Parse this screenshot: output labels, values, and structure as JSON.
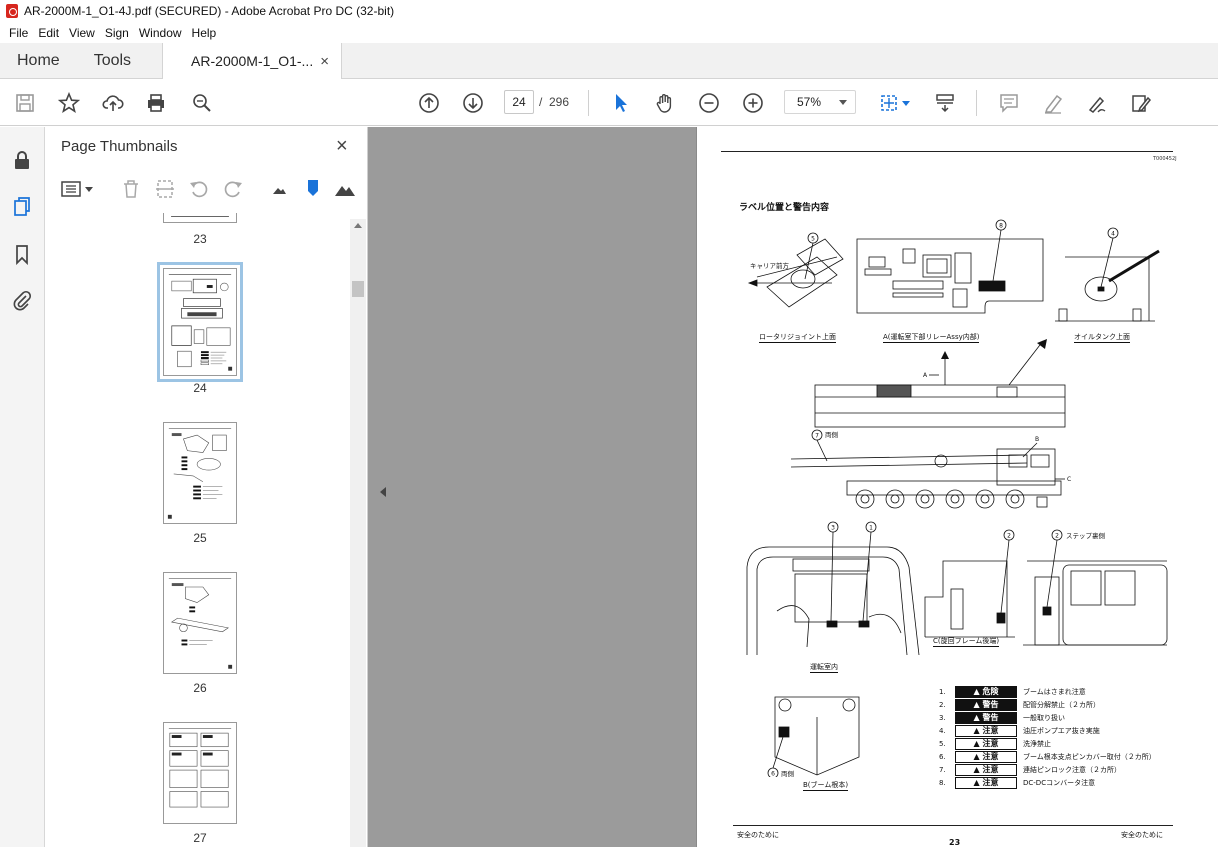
{
  "window": {
    "title": "AR-2000M-1_O1-4J.pdf (SECURED) - Adobe Acrobat Pro DC (32-bit)"
  },
  "menu": {
    "items": [
      "File",
      "Edit",
      "View",
      "Sign",
      "Window",
      "Help"
    ]
  },
  "tabs": {
    "home": "Home",
    "tools": "Tools",
    "document": "AR-2000M-1_O1-...",
    "close": "×"
  },
  "toolbar": {
    "current_page": "24",
    "page_separator": "/",
    "total_pages": "296",
    "zoom": "57%"
  },
  "panel": {
    "title": "Page Thumbnails",
    "close": "×",
    "thumb_labels": [
      "23",
      "24",
      "25",
      "26",
      "27"
    ]
  },
  "page": {
    "code": "T000452J",
    "heading": "ラベル位置と警告内容",
    "captions": {
      "rotary": "ロータリジョイント上面",
      "relay": "A(運転室下部リレーAssy内部)",
      "oil_tank": "オイルタンク上面",
      "cab": "運転室内",
      "frame": "C(旋回フレーム後端)",
      "boom": "B(ブーム根本)"
    },
    "callouts": {
      "carrier_front": "キャリア前方",
      "both_sides_7": "両側",
      "step_back": "ステップ裏側",
      "both_sides_6": "両側",
      "a": "A",
      "b": "B",
      "c": "C",
      "n1": "1",
      "n2": "2",
      "n3": "3",
      "n4": "4",
      "n5": "5",
      "n6": "6",
      "n7": "7",
      "n8": "8"
    },
    "legend": [
      {
        "num": "1.",
        "badge": "危険",
        "style": "dark",
        "text": "ブームはさまれ注意"
      },
      {
        "num": "2.",
        "badge": "警告",
        "style": "dark",
        "text": "配管分解禁止（２カ所）"
      },
      {
        "num": "3.",
        "badge": "警告",
        "style": "dark",
        "text": "一般取り扱い"
      },
      {
        "num": "4.",
        "badge": "注意",
        "style": "light",
        "text": "油圧ポンプエア抜き実施"
      },
      {
        "num": "5.",
        "badge": "注意",
        "style": "light",
        "text": "洗浄禁止"
      },
      {
        "num": "6.",
        "badge": "注意",
        "style": "light",
        "text": "ブーム根本支点ピンカバー取付（２カ所）"
      },
      {
        "num": "7.",
        "badge": "注意",
        "style": "light",
        "text": "連結ピンロック注意（２カ所）"
      },
      {
        "num": "8.",
        "badge": "注意",
        "style": "light",
        "text": "DC-DCコンバータ注意"
      }
    ],
    "footer_left": "安全のために",
    "footer_right": "安全のために",
    "page_number": "23"
  }
}
